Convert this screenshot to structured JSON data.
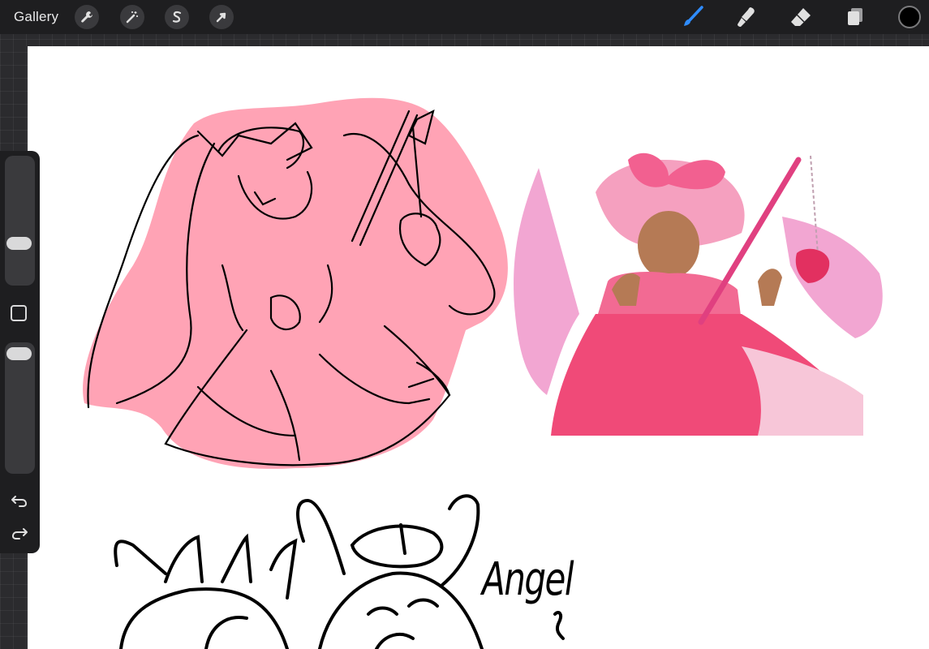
{
  "topbar": {
    "gallery_label": "Gallery",
    "left_tools": [
      {
        "icon": "wrench-icon",
        "name": "actions"
      },
      {
        "icon": "magic-wand-icon",
        "name": "adjustments"
      },
      {
        "icon": "selection-s-icon",
        "name": "selection"
      },
      {
        "icon": "arrow-cursor-icon",
        "name": "transform"
      }
    ],
    "right_tools": [
      {
        "icon": "brush-icon",
        "name": "brush",
        "active_color": "#2f8cff"
      },
      {
        "icon": "smudge-icon",
        "name": "smudge"
      },
      {
        "icon": "eraser-icon",
        "name": "eraser"
      },
      {
        "icon": "layers-icon",
        "name": "layers"
      }
    ],
    "current_color": "#000000"
  },
  "sidebar": {
    "brush_size_icon": "size-slider-icon",
    "modify_icon": "square-modify-icon",
    "opacity_icon": "opacity-slider-icon",
    "undo_icon": "undo-icon",
    "redo_icon": "redo-icon"
  },
  "canvas": {
    "handwritten_text": "Angel",
    "colors": {
      "sketch_fill": "#ffa3b5",
      "dress_pink": "#f04a78",
      "hair_pink": "#f2a6d2",
      "skin": "#b57a55",
      "ink": "#000000"
    }
  }
}
